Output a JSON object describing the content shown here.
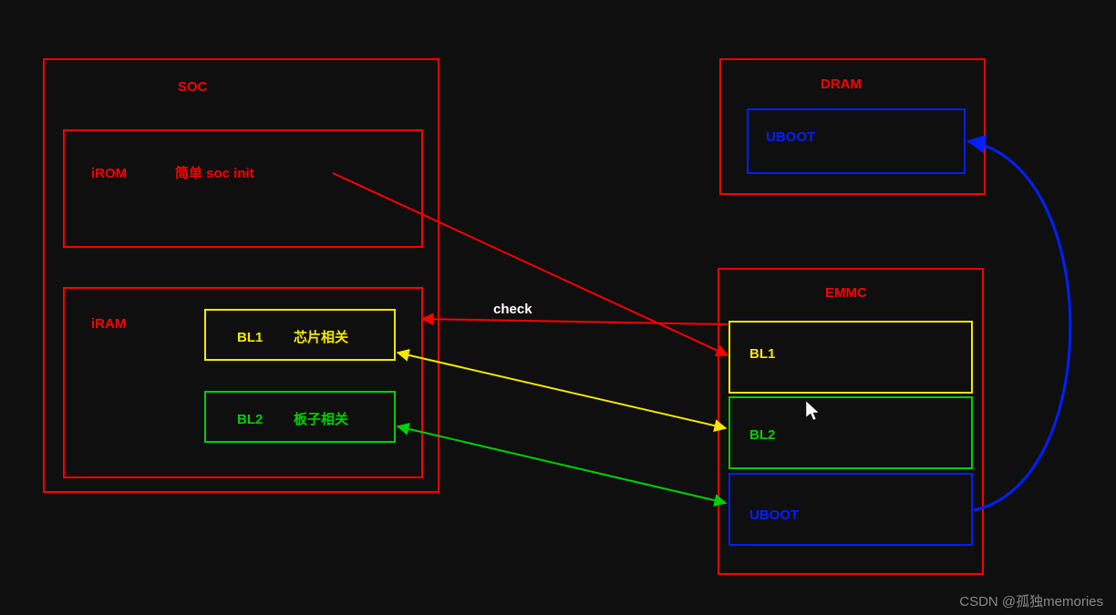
{
  "soc": {
    "title": "SOC",
    "irom": {
      "label": "iROM",
      "desc": "简单 soc init"
    },
    "iram": {
      "label": "iRAM",
      "bl1": {
        "name": "BL1",
        "desc": "芯片相关"
      },
      "bl2": {
        "name": "BL2",
        "desc": "板子相关"
      }
    }
  },
  "dram": {
    "title": "DRAM",
    "uboot": "UBOOT"
  },
  "emmc": {
    "title": "EMMC",
    "bl1": "BL1",
    "bl2": "BL2",
    "uboot": "UBOOT"
  },
  "arrows": {
    "check_label": "check"
  },
  "watermark": "CSDN @孤独memories"
}
